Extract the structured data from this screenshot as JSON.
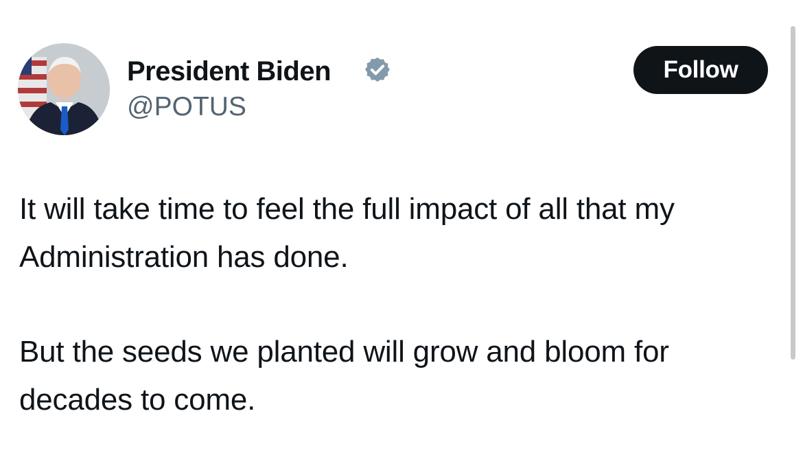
{
  "author": {
    "display_name": "President Biden",
    "handle": "@POTUS",
    "verified_icon": "verified-badge-icon",
    "badge_color": "#829aab"
  },
  "actions": {
    "follow_label": "Follow"
  },
  "tweet": {
    "paragraphs": [
      "It will take time to feel the full impact of all that my Administration has done.",
      "But the seeds we planted will grow and bloom for decades to come."
    ]
  },
  "colors": {
    "text": "#0f1419",
    "secondary_text": "#536471",
    "follow_bg": "#0f1419",
    "follow_text": "#ffffff"
  }
}
